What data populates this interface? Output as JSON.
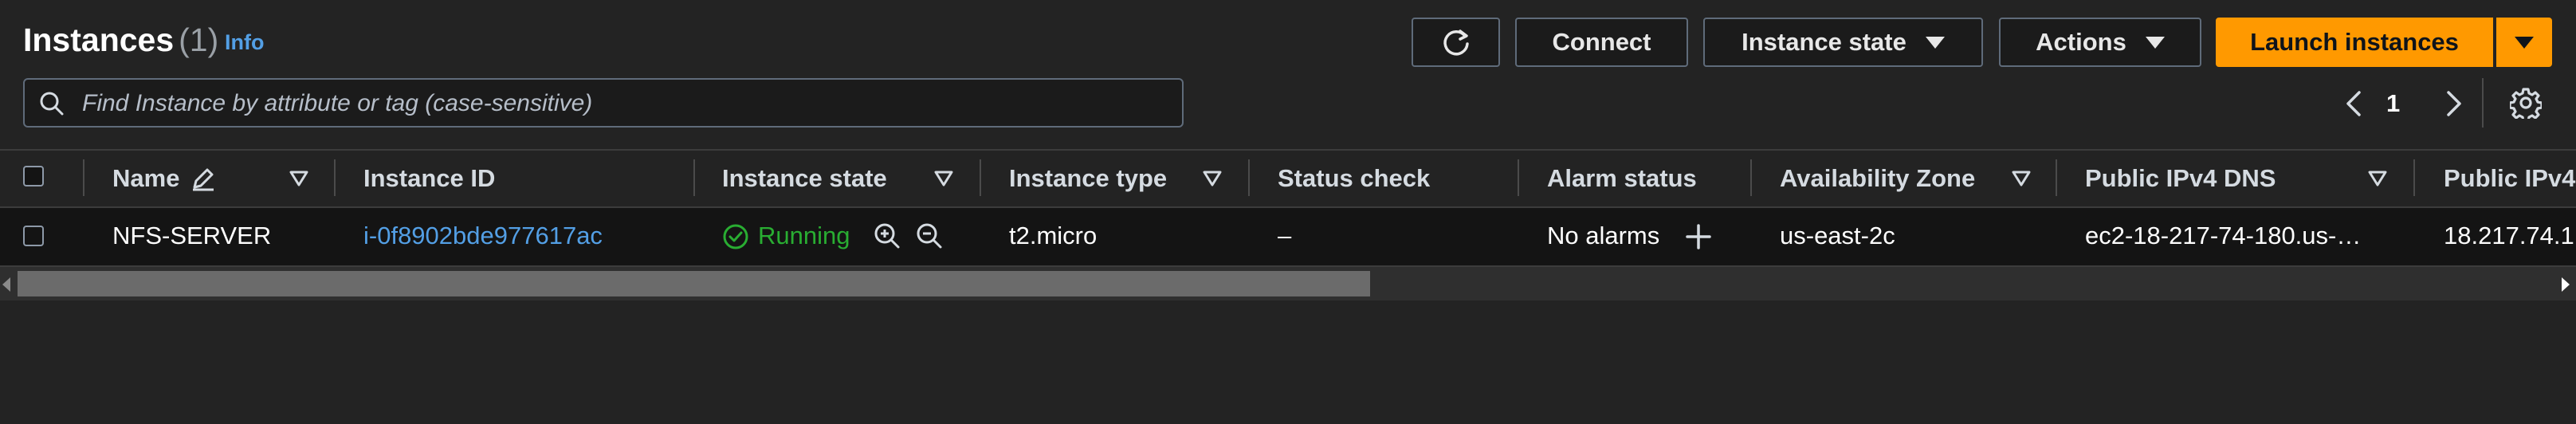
{
  "header": {
    "title": "Instances",
    "count": "(1)",
    "info_label": "Info"
  },
  "toolbar": {
    "refresh_icon": "refresh-icon",
    "connect_label": "Connect",
    "instance_state_label": "Instance state",
    "actions_label": "Actions",
    "launch_label": "Launch instances"
  },
  "search": {
    "placeholder": "Find Instance by attribute or tag (case-sensitive)",
    "value": ""
  },
  "pagination": {
    "current_page": "1"
  },
  "table": {
    "columns": [
      "Name",
      "Instance ID",
      "Instance state",
      "Instance type",
      "Status check",
      "Alarm status",
      "Availability Zone",
      "Public IPv4 DNS",
      "Public IPv4"
    ],
    "rows": [
      {
        "name": "NFS-SERVER",
        "instance_id": "i-0f8902bde977617ac",
        "instance_state": "Running",
        "instance_type": "t2.micro",
        "status_check": "–",
        "alarm_status": "No alarms",
        "availability_zone": "us-east-2c",
        "public_ipv4_dns": "ec2-18-217-74-180.us-…",
        "public_ipv4": "18.217.74.1"
      }
    ]
  },
  "colors": {
    "background": "#232323",
    "row_background": "#141414",
    "accent": "#ff9900",
    "link": "#539fe5",
    "running": "#29ad32"
  }
}
